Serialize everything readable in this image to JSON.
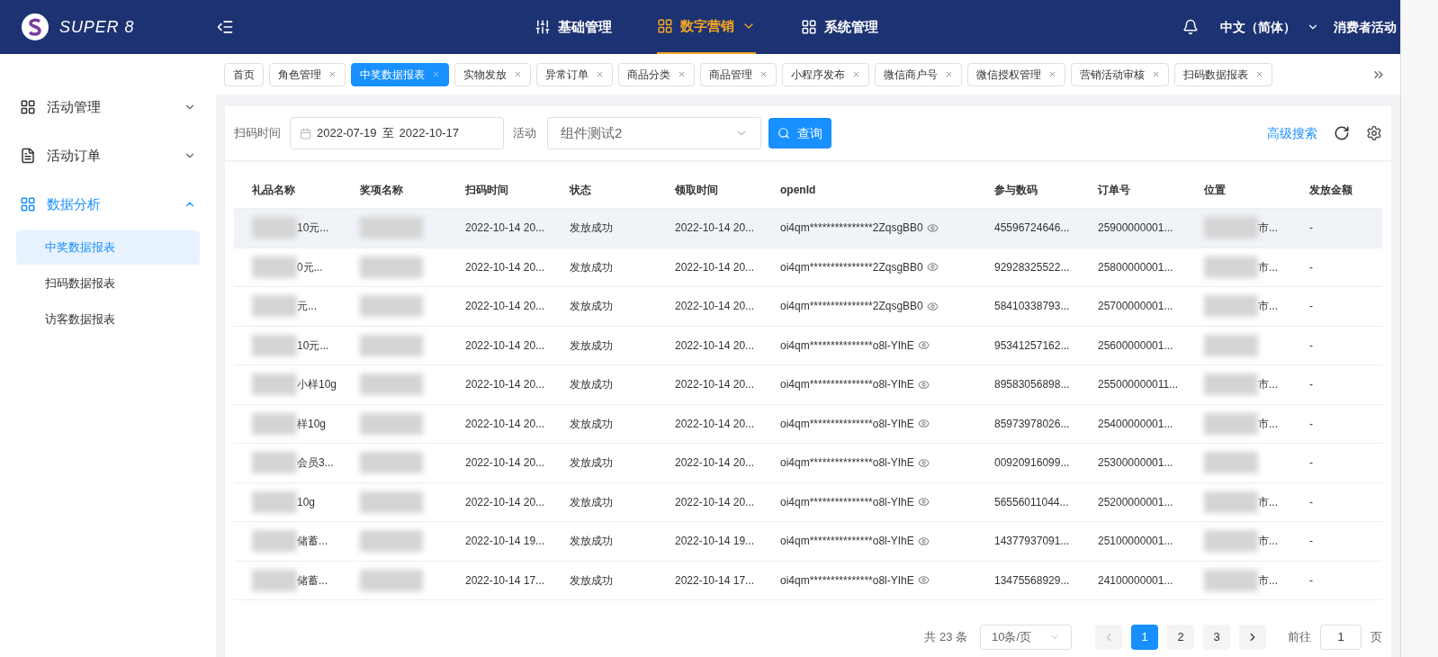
{
  "header": {
    "logo_text": "SUPER 8",
    "nav": [
      {
        "label": "基础管理",
        "selected": false,
        "kind": "sliders"
      },
      {
        "label": "数字营销",
        "selected": true,
        "kind": "grid"
      },
      {
        "label": "系统管理",
        "selected": false,
        "kind": "grid"
      }
    ],
    "language": "中文（简体）",
    "user": "消费者活动"
  },
  "sidebar": {
    "items": [
      {
        "label": "活动管理",
        "kind": "grid",
        "expanded": false,
        "selected": false
      },
      {
        "label": "活动订单",
        "kind": "doc",
        "expanded": false,
        "selected": false
      },
      {
        "label": "数据分析",
        "kind": "grid",
        "expanded": true,
        "selected": true,
        "children": [
          {
            "label": "中奖数据报表",
            "selected": true
          },
          {
            "label": "扫码数据报表",
            "selected": false
          },
          {
            "label": "访客数据报表",
            "selected": false
          }
        ]
      }
    ]
  },
  "tabs": [
    {
      "label": "首页",
      "selected": false,
      "closable": false
    },
    {
      "label": "角色管理",
      "selected": false,
      "closable": true
    },
    {
      "label": "中奖数据报表",
      "selected": true,
      "closable": true
    },
    {
      "label": "实物发放",
      "selected": false,
      "closable": true
    },
    {
      "label": "异常订单",
      "selected": false,
      "closable": true
    },
    {
      "label": "商品分类",
      "selected": false,
      "closable": true
    },
    {
      "label": "商品管理",
      "selected": false,
      "closable": true
    },
    {
      "label": "小程序发布",
      "selected": false,
      "closable": true
    },
    {
      "label": "微信商户号",
      "selected": false,
      "closable": true
    },
    {
      "label": "微信授权管理",
      "selected": false,
      "closable": true
    },
    {
      "label": "营销活动审核",
      "selected": false,
      "closable": true
    },
    {
      "label": "扫码数据报表",
      "selected": false,
      "closable": true
    }
  ],
  "filters": {
    "scan_time_label": "扫码时间",
    "date_from": "2022-07-19",
    "date_sep": "至",
    "date_to": "2022-10-17",
    "activity_label": "活动",
    "activity_value": "组件测试2",
    "query_button": "查询",
    "advanced_search": "高级搜索"
  },
  "table": {
    "columns": [
      "礼品名称",
      "奖项名称",
      "扫码时间",
      "状态",
      "领取时间",
      "openId",
      "参与数码",
      "订单号",
      "位置",
      "发放金额"
    ],
    "rows": [
      {
        "gift": "10元...",
        "scan_time": "2022-10-14 20...",
        "status": "发放成功",
        "claim_time": "2022-10-14 20...",
        "open_id": "oi4qm***************2ZqsgBB0",
        "code": "45596724646...",
        "order": "25900000001...",
        "location": "市...",
        "amount": "-",
        "selected": true
      },
      {
        "gift": "0元...",
        "scan_time": "2022-10-14 20...",
        "status": "发放成功",
        "claim_time": "2022-10-14 20...",
        "open_id": "oi4qm***************2ZqsgBB0",
        "code": "92928325522...",
        "order": "25800000001...",
        "location": "市...",
        "amount": "-",
        "selected": false
      },
      {
        "gift": "元...",
        "scan_time": "2022-10-14 20...",
        "status": "发放成功",
        "claim_time": "2022-10-14 20...",
        "open_id": "oi4qm***************2ZqsgBB0",
        "code": "58410338793...",
        "order": "25700000001...",
        "location": "市...",
        "amount": "-",
        "selected": false
      },
      {
        "gift": "10元...",
        "scan_time": "2022-10-14 20...",
        "status": "发放成功",
        "claim_time": "2022-10-14 20...",
        "open_id": "oi4qm***************o8l-YIhE",
        "code": "95341257162...",
        "order": "25600000001...",
        "amount": "-",
        "selected": false
      },
      {
        "gift": "小样10g",
        "scan_time": "2022-10-14 20...",
        "status": "发放成功",
        "claim_time": "2022-10-14 20...",
        "open_id": "oi4qm***************o8l-YIhE",
        "code": "89583056898...",
        "order": "255000000011...",
        "location": "市...",
        "amount": "-",
        "selected": false
      },
      {
        "gift": "样10g",
        "scan_time": "2022-10-14 20...",
        "status": "发放成功",
        "claim_time": "2022-10-14 20...",
        "open_id": "oi4qm***************o8l-YIhE",
        "code": "85973978026...",
        "order": "25400000001...",
        "location": "市...",
        "amount": "-",
        "selected": false
      },
      {
        "gift": "会员3...",
        "scan_time": "2022-10-14 20...",
        "status": "发放成功",
        "claim_time": "2022-10-14 20...",
        "open_id": "oi4qm***************o8l-YIhE",
        "code": "00920916099...",
        "order": "25300000001...",
        "amount": "-",
        "selected": false
      },
      {
        "gift": "10g",
        "scan_time": "2022-10-14 20...",
        "status": "发放成功",
        "claim_time": "2022-10-14 20...",
        "open_id": "oi4qm***************o8l-YIhE",
        "code": "56556011044...",
        "order": "25200000001...",
        "location": "市...",
        "amount": "-",
        "selected": false
      },
      {
        "gift": "储蓄...",
        "scan_time": "2022-10-14 19...",
        "status": "发放成功",
        "claim_time": "2022-10-14 19...",
        "open_id": "oi4qm***************o8l-YIhE",
        "code": "14377937091...",
        "order": "25100000001...",
        "location": "市...",
        "amount": "-",
        "selected": false
      },
      {
        "gift": "储蓄...",
        "scan_time": "2022-10-14 17...",
        "status": "发放成功",
        "claim_time": "2022-10-14 17...",
        "open_id": "oi4qm***************o8l-YIhE",
        "code": "13475568929...",
        "order": "24100000001...",
        "location": "市...",
        "amount": "-",
        "selected": false
      }
    ]
  },
  "pagination": {
    "total": "共 23 条",
    "page_size": "10条/页",
    "pages": [
      {
        "label": "1",
        "selected": true
      },
      {
        "label": "2",
        "selected": false
      },
      {
        "label": "3",
        "selected": false
      }
    ],
    "goto_label": "前往",
    "goto_value": "1",
    "page_unit": "页"
  }
}
